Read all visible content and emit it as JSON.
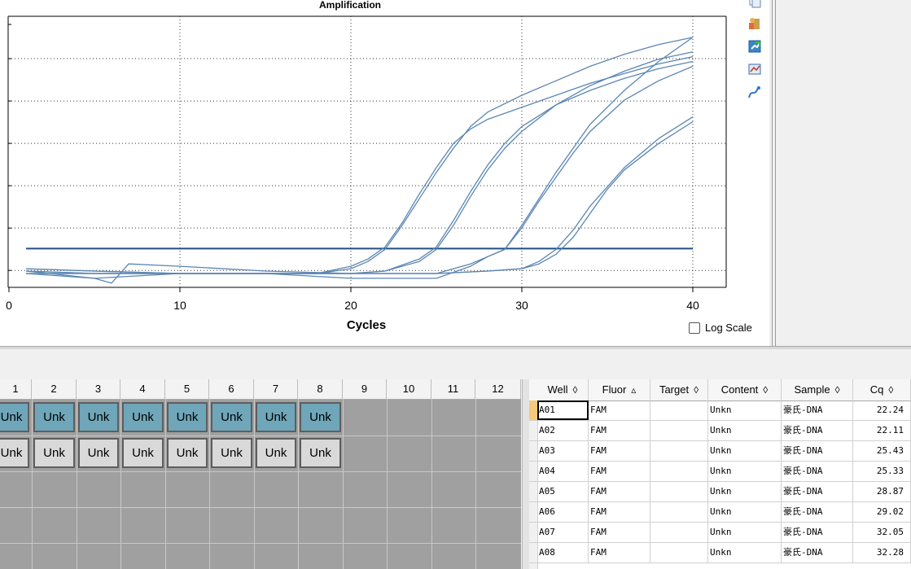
{
  "chart": {
    "title": "Amplification",
    "xlabel": "Cycles",
    "log_scale_label": "Log Scale",
    "x_ticks": [
      "0",
      "10",
      "20",
      "30",
      "40"
    ]
  },
  "chart_data": {
    "type": "line",
    "title": "Amplification",
    "xlabel": "Cycles",
    "ylabel": "",
    "xlim": [
      0,
      41
    ],
    "grid": true,
    "threshold": 0.1,
    "series": [
      {
        "well": "A01",
        "cq": 22.24,
        "x": [
          1,
          5,
          10,
          15,
          18,
          20,
          21,
          22,
          23,
          24,
          25,
          26,
          27,
          28,
          30,
          32,
          34,
          36,
          38,
          40
        ],
        "y": [
          0.02,
          0.01,
          0.0,
          0.0,
          0.0,
          0.02,
          0.05,
          0.1,
          0.2,
          0.31,
          0.42,
          0.52,
          0.61,
          0.67,
          0.74,
          0.8,
          0.86,
          0.91,
          0.95,
          0.98
        ]
      },
      {
        "well": "A02",
        "cq": 22.11,
        "x": [
          1,
          5,
          10,
          15,
          18,
          20,
          21,
          22,
          23,
          24,
          25,
          26,
          27,
          28,
          30,
          32,
          34,
          36,
          38,
          40
        ],
        "y": [
          0.02,
          0.01,
          0.0,
          0.0,
          0.0,
          0.03,
          0.06,
          0.11,
          0.21,
          0.33,
          0.44,
          0.54,
          0.6,
          0.64,
          0.69,
          0.74,
          0.79,
          0.83,
          0.87,
          0.9
        ]
      },
      {
        "well": "A03",
        "cq": 25.43,
        "x": [
          1,
          5,
          10,
          15,
          20,
          22,
          24,
          25,
          26,
          27,
          28,
          29,
          30,
          32,
          34,
          36,
          38,
          40
        ],
        "y": [
          0.0,
          0.0,
          0.0,
          0.0,
          0.0,
          0.01,
          0.05,
          0.1,
          0.2,
          0.32,
          0.43,
          0.52,
          0.59,
          0.7,
          0.78,
          0.84,
          0.89,
          0.92
        ]
      },
      {
        "well": "A04",
        "cq": 25.33,
        "x": [
          1,
          5,
          10,
          15,
          20,
          22,
          24,
          25,
          26,
          27,
          28,
          29,
          30,
          32,
          34,
          36,
          38,
          40
        ],
        "y": [
          0.0,
          0.0,
          0.0,
          0.0,
          0.0,
          0.01,
          0.06,
          0.11,
          0.22,
          0.34,
          0.45,
          0.54,
          0.61,
          0.7,
          0.76,
          0.81,
          0.85,
          0.88
        ]
      },
      {
        "well": "A05",
        "cq": 28.87,
        "x": [
          1,
          5,
          10,
          15,
          20,
          25,
          27,
          28,
          29,
          30,
          31,
          32,
          33,
          34,
          36,
          38,
          40
        ],
        "y": [
          0.01,
          0.0,
          0.0,
          0.0,
          0.0,
          0.0,
          0.04,
          0.07,
          0.1,
          0.2,
          0.31,
          0.42,
          0.52,
          0.62,
          0.76,
          0.88,
          0.98
        ]
      },
      {
        "well": "A06",
        "cq": 29.02,
        "x": [
          1,
          5,
          10,
          15,
          20,
          25,
          27,
          28,
          29,
          30,
          31,
          32,
          33,
          34,
          36,
          38,
          40
        ],
        "y": [
          0.01,
          -0.02,
          0.0,
          0.0,
          -0.02,
          -0.02,
          0.03,
          0.07,
          0.1,
          0.19,
          0.3,
          0.4,
          0.5,
          0.59,
          0.72,
          0.8,
          0.86
        ]
      },
      {
        "well": "A07",
        "cq": 32.05,
        "x": [
          1,
          5,
          6,
          7,
          10,
          15,
          20,
          25,
          28,
          30,
          31,
          32,
          33,
          34,
          35,
          36,
          38,
          40
        ],
        "y": [
          0.0,
          -0.02,
          -0.04,
          0.04,
          0.03,
          0.01,
          0.0,
          0.0,
          0.01,
          0.02,
          0.05,
          0.1,
          0.18,
          0.28,
          0.36,
          0.44,
          0.56,
          0.65
        ]
      },
      {
        "well": "A08",
        "cq": 32.28,
        "x": [
          1,
          5,
          10,
          15,
          20,
          25,
          28,
          30,
          31,
          32,
          33,
          34,
          35,
          36,
          38,
          40
        ],
        "y": [
          0.01,
          0.0,
          0.0,
          0.0,
          0.0,
          0.0,
          0.01,
          0.02,
          0.04,
          0.08,
          0.15,
          0.25,
          0.35,
          0.43,
          0.54,
          0.63
        ]
      }
    ]
  },
  "toolbar": {
    "icons": [
      "copy-icon",
      "export-icon",
      "export-graph-icon",
      "chart-settings-icon",
      "curve-tool-icon"
    ]
  },
  "plate": {
    "columns": [
      "1",
      "2",
      "3",
      "4",
      "5",
      "6",
      "7",
      "8",
      "9",
      "10",
      "11",
      "12"
    ],
    "row_a": [
      "Unk",
      "Unk",
      "Unk",
      "Unk",
      "Unk",
      "Unk",
      "Unk",
      "Unk"
    ],
    "row_b": [
      "Unk",
      "Unk",
      "Unk",
      "Unk",
      "Unk",
      "Unk",
      "Unk",
      "Unk"
    ]
  },
  "results": {
    "headers": [
      "Well",
      "Fluor",
      "Target",
      "Content",
      "Sample",
      "Cq"
    ],
    "header_arrows": [
      "◊",
      "▵",
      "◊",
      "◊",
      "◊",
      "◊"
    ],
    "rows": [
      {
        "well": "A01",
        "fluor": "FAM",
        "target": "",
        "content": "Unkn",
        "sample": "豪氏-DNA",
        "cq": "22.24"
      },
      {
        "well": "A02",
        "fluor": "FAM",
        "target": "",
        "content": "Unkn",
        "sample": "豪氏-DNA",
        "cq": "22.11"
      },
      {
        "well": "A03",
        "fluor": "FAM",
        "target": "",
        "content": "Unkn",
        "sample": "豪氏-DNA",
        "cq": "25.43"
      },
      {
        "well": "A04",
        "fluor": "FAM",
        "target": "",
        "content": "Unkn",
        "sample": "豪氏-DNA",
        "cq": "25.33"
      },
      {
        "well": "A05",
        "fluor": "FAM",
        "target": "",
        "content": "Unkn",
        "sample": "豪氏-DNA",
        "cq": "28.87"
      },
      {
        "well": "A06",
        "fluor": "FAM",
        "target": "",
        "content": "Unkn",
        "sample": "豪氏-DNA",
        "cq": "29.02"
      },
      {
        "well": "A07",
        "fluor": "FAM",
        "target": "",
        "content": "Unkn",
        "sample": "豪氏-DNA",
        "cq": "32.05"
      },
      {
        "well": "A08",
        "fluor": "FAM",
        "target": "",
        "content": "Unkn",
        "sample": "豪氏-DNA",
        "cq": "32.28"
      }
    ]
  },
  "colors": {
    "curve": "#5b86b3",
    "threshold": "#1f4f86",
    "well_selected": "#6fa6b9",
    "well_unselected": "#d9d9d9"
  }
}
